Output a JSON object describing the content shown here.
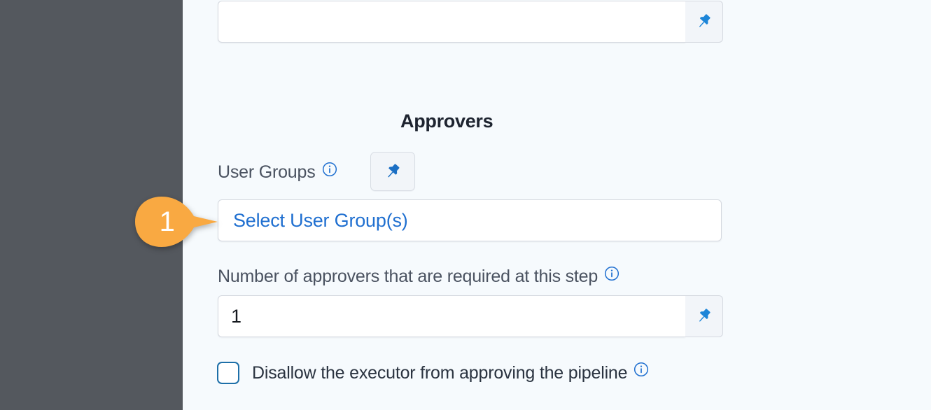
{
  "layout": {
    "gutter_color": "#54585e",
    "panel_background": "#f6fafd",
    "accent_blue": "#1f6fd0",
    "callout_orange": "#f9a942"
  },
  "fields": {
    "top_input": {
      "value": "",
      "placeholder": "",
      "pin_icon": "pin-icon"
    },
    "user_groups": {
      "label": "User Groups",
      "info_icon": "info-icon",
      "pin_icon": "pin-icon",
      "select_placeholder": "Select User Group(s)"
    },
    "approver_count": {
      "label": "Number of approvers that are required at this step",
      "info_icon": "info-icon",
      "value": "1",
      "pin_icon": "pin-icon"
    },
    "disallow_executor": {
      "label": "Disallow the executor from approving the pipeline",
      "info_icon": "info-icon",
      "checked": false
    }
  },
  "section": {
    "heading": "Approvers"
  },
  "callouts": [
    {
      "number": "1",
      "target": "select-user-groups-field",
      "color": "#f9a942"
    }
  ]
}
